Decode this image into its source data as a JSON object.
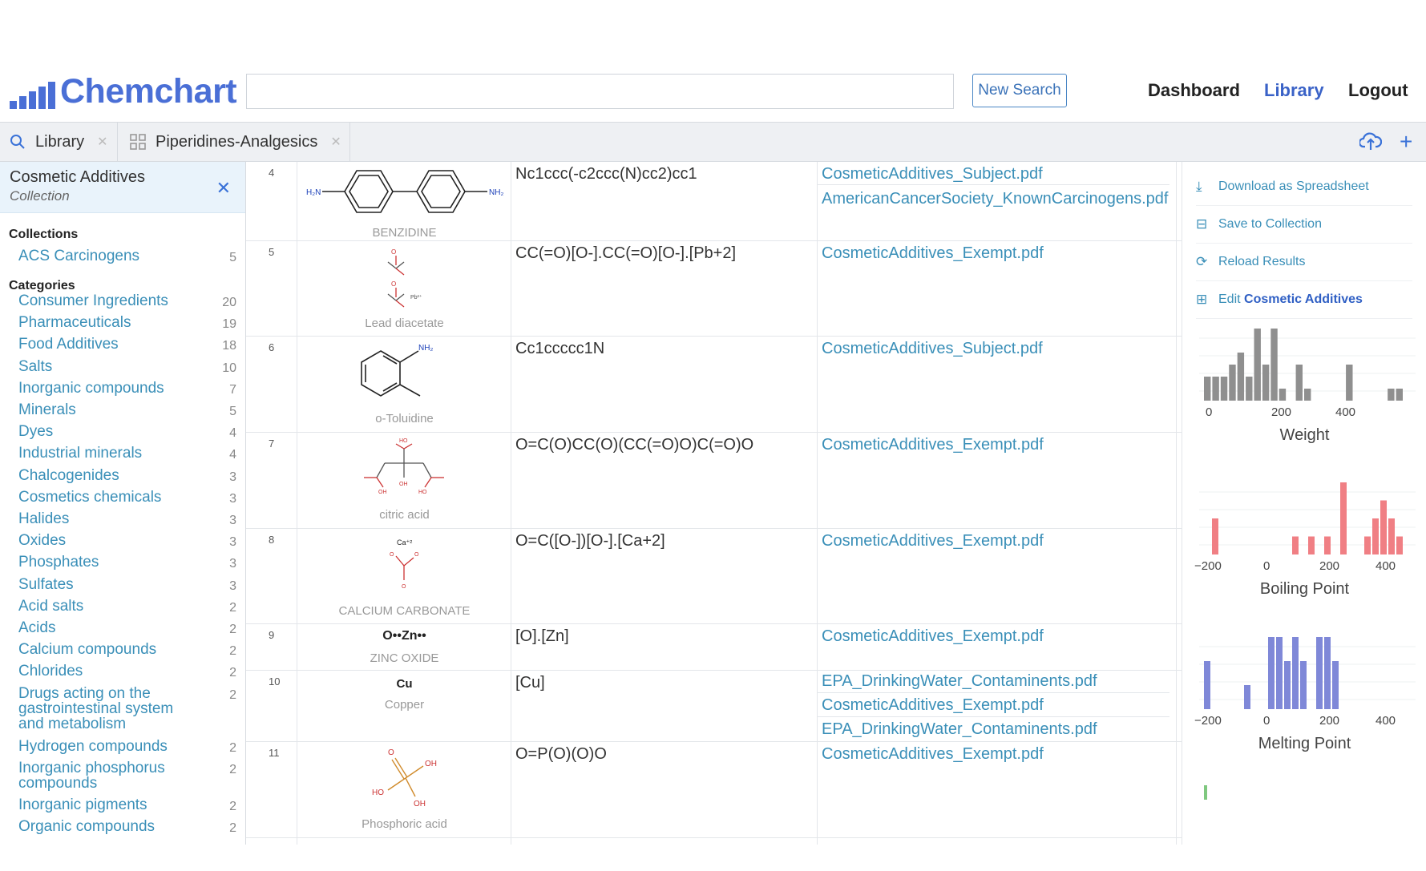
{
  "app": {
    "logo_text": "Chemchart"
  },
  "header": {
    "search_value": "",
    "new_search_label": "New Search",
    "nav": [
      "Dashboard",
      "Library",
      "Logout"
    ]
  },
  "tabs": [
    {
      "icon": "search-icon",
      "label": "Library"
    },
    {
      "icon": "grid-icon",
      "label": "Piperidines-Analgesics"
    }
  ],
  "sidebar": {
    "collection_title": "Cosmetic Additives",
    "collection_subtitle": "Collection",
    "collections_heading": "Collections",
    "collections": [
      {
        "label": "ACS Carcinogens",
        "count": "5"
      }
    ],
    "categories_heading": "Categories",
    "categories": [
      {
        "label": "Consumer Ingredients",
        "count": "20"
      },
      {
        "label": "Pharmaceuticals",
        "count": "19"
      },
      {
        "label": "Food Additives",
        "count": "18"
      },
      {
        "label": "Salts",
        "count": "10"
      },
      {
        "label": "Inorganic compounds",
        "count": "7"
      },
      {
        "label": "Minerals",
        "count": "5"
      },
      {
        "label": "Dyes",
        "count": "4"
      },
      {
        "label": "Industrial minerals",
        "count": "4"
      },
      {
        "label": "Chalcogenides",
        "count": "3"
      },
      {
        "label": "Cosmetics chemicals",
        "count": "3"
      },
      {
        "label": "Halides",
        "count": "3"
      },
      {
        "label": "Oxides",
        "count": "3"
      },
      {
        "label": "Phosphates",
        "count": "3"
      },
      {
        "label": "Sulfates",
        "count": "3"
      },
      {
        "label": "Acid salts",
        "count": "2"
      },
      {
        "label": "Acids",
        "count": "2"
      },
      {
        "label": "Calcium compounds",
        "count": "2"
      },
      {
        "label": "Chlorides",
        "count": "2"
      },
      {
        "label": "Drugs acting on the gastrointestinal system and metabolism",
        "count": "2"
      },
      {
        "label": "Hydrogen compounds",
        "count": "2"
      },
      {
        "label": "Inorganic phosphorus compounds",
        "count": "2"
      },
      {
        "label": "Inorganic pigments",
        "count": "2"
      },
      {
        "label": "Organic compounds",
        "count": "2"
      }
    ]
  },
  "rows": [
    {
      "index": "4",
      "name": "BENZIDINE",
      "smiles": "Nc1ccc(-c2ccc(N)cc2)cc1",
      "docs": [
        "CosmeticAdditives_Subject.pdf",
        "AmericanCancerSociety_KnownCarcinogens.pdf"
      ]
    },
    {
      "index": "5",
      "name": "Lead diacetate",
      "smiles": "CC(=O)[O-].CC(=O)[O-].[Pb+2]",
      "docs": [
        "CosmeticAdditives_Exempt.pdf"
      ]
    },
    {
      "index": "6",
      "name": "o-Toluidine",
      "smiles": "Cc1ccccc1N",
      "docs": [
        "CosmeticAdditives_Subject.pdf"
      ]
    },
    {
      "index": "7",
      "name": "citric acid",
      "smiles": "O=C(O)CC(O)(CC(=O)O)C(=O)O",
      "docs": [
        "CosmeticAdditives_Exempt.pdf"
      ]
    },
    {
      "index": "8",
      "name": "CALCIUM CARBONATE",
      "smiles": "O=C([O-])[O-].[Ca+2]",
      "docs": [
        "CosmeticAdditives_Exempt.pdf"
      ]
    },
    {
      "index": "9",
      "name": "ZINC OXIDE",
      "smiles": "[O].[Zn]",
      "docs": [
        "CosmeticAdditives_Exempt.pdf"
      ]
    },
    {
      "index": "10",
      "name": "Copper",
      "smiles": "[Cu]",
      "docs": [
        "EPA_DrinkingWater_Contaminents.pdf",
        "CosmeticAdditives_Exempt.pdf",
        "EPA_DrinkingWater_Contaminents.pdf"
      ]
    },
    {
      "index": "11",
      "name": "Phosphoric acid",
      "smiles": "O=P(O)(O)O",
      "docs": [
        "CosmeticAdditives_Exempt.pdf"
      ]
    }
  ],
  "structure_labels": {
    "benzidine_left": "H₂N",
    "benzidine_right": "NH₂",
    "toluidine_nh2": "NH₂",
    "ca": "Ca⁺²",
    "zn": "O••Zn••",
    "cu": "Cu",
    "oh": "OH",
    "ho": "HO",
    "o": "O",
    "pb": "Pb²⁺"
  },
  "actions": {
    "download": "Download as Spreadsheet",
    "save": "Save to Collection",
    "reload": "Reload Results",
    "edit_prefix": "Edit",
    "edit_target": "Cosmetic Additives"
  },
  "histograms": [
    {
      "title": "Weight",
      "color": "#8f8f8f",
      "ticks": [
        "0",
        "200",
        "400"
      ],
      "bins": [
        2,
        2,
        2,
        3,
        4,
        2,
        6,
        3,
        6,
        1,
        0,
        3,
        1,
        0,
        0,
        0,
        0,
        3,
        0,
        0,
        0,
        0,
        1,
        1
      ]
    },
    {
      "title": "Boiling Point",
      "color": "#f07f84",
      "ticks": [
        "−200",
        "0",
        "200",
        "400"
      ],
      "bins": [
        0,
        2,
        0,
        0,
        0,
        0,
        0,
        0,
        0,
        0,
        0,
        1,
        0,
        1,
        0,
        1,
        0,
        4,
        0,
        0,
        1,
        2,
        3,
        2,
        1
      ]
    },
    {
      "title": "Melting Point",
      "color": "#7f88d8",
      "ticks": [
        "−200",
        "0",
        "200",
        "400"
      ],
      "bins": [
        2,
        0,
        0,
        0,
        0,
        1,
        0,
        0,
        3,
        3,
        2,
        3,
        2,
        0,
        3,
        3,
        2,
        0,
        0,
        0,
        0,
        0,
        0,
        0,
        0
      ]
    }
  ],
  "colors": {
    "accent": "#3a62c7",
    "link": "#3a8fb8"
  }
}
